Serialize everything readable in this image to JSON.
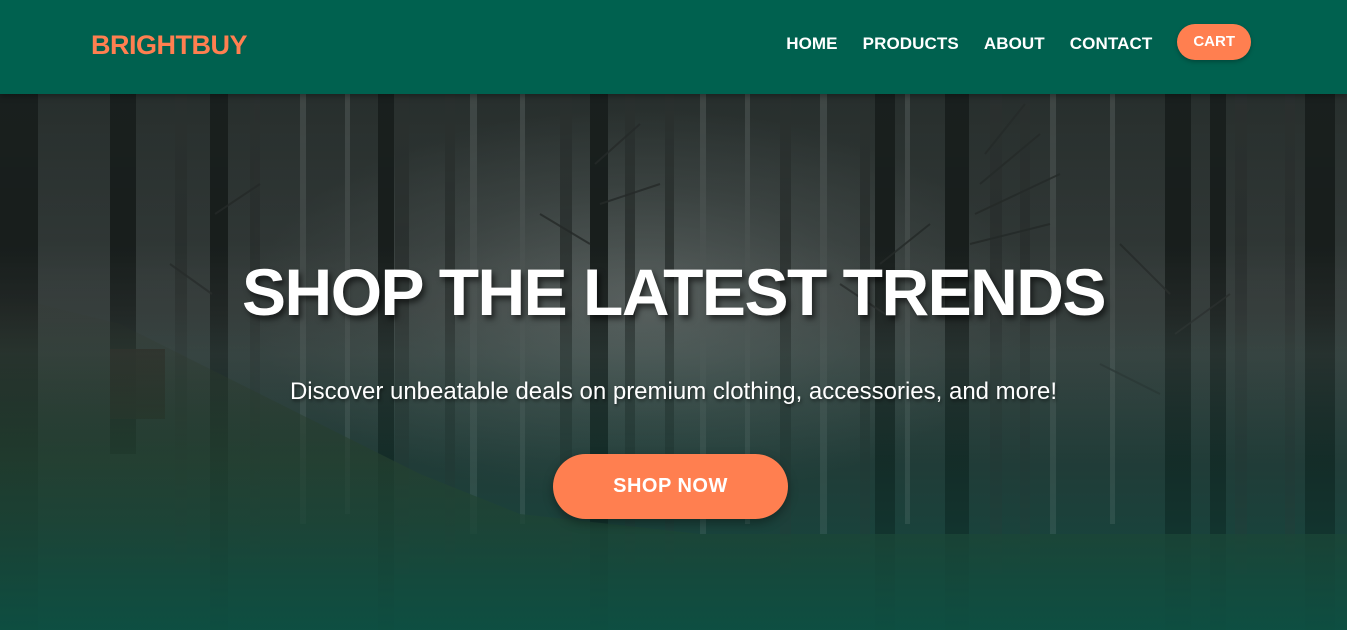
{
  "brand": {
    "name": "BRIGHTBUY",
    "color": "#ff7f50"
  },
  "nav": {
    "items": [
      {
        "label": "HOME"
      },
      {
        "label": "PRODUCTS"
      },
      {
        "label": "ABOUT"
      },
      {
        "label": "CONTACT"
      }
    ],
    "cart_label": "CART"
  },
  "hero": {
    "title": "SHOP THE LATEST TRENDS",
    "subtitle": "Discover unbeatable deals on premium clothing, accessories, and more!",
    "cta_label": "SHOP NOW",
    "background_image": "misty-forest"
  },
  "colors": {
    "header_bg": "#00614f",
    "accent": "#ff7f50",
    "text_light": "#ffffff"
  }
}
